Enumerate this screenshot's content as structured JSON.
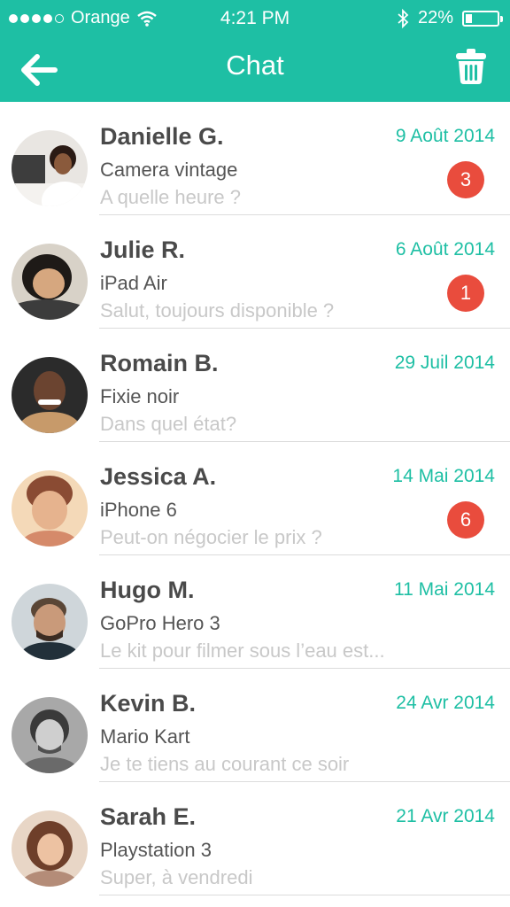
{
  "status_bar": {
    "carrier": "Orange",
    "time": "4:21 PM",
    "battery": "22%",
    "battery_level": 0.22,
    "signal_bars_filled": 4,
    "signal_bars_total": 5
  },
  "header": {
    "title": "Chat",
    "back_icon": "arrow-left-icon",
    "trash_icon": "trash-icon",
    "background_color": "#1ebfa4"
  },
  "colors": {
    "accent": "#1ebfa4",
    "badge": "#e94c3d"
  },
  "conversations": [
    {
      "name": "Danielle G.",
      "item": "Camera vintage",
      "preview": "A quelle heure ?",
      "date": "9 Août 2014",
      "unread": "3",
      "avatar": "avatar-danielle"
    },
    {
      "name": "Julie R.",
      "item": "iPad Air",
      "preview": "Salut, toujours disponible ?",
      "date": "6 Août 2014",
      "unread": "1",
      "avatar": "avatar-julie"
    },
    {
      "name": "Romain B.",
      "item": "Fixie noir",
      "preview": "Dans quel état?",
      "date": "29 Juil 2014",
      "unread": "",
      "avatar": "avatar-romain"
    },
    {
      "name": "Jessica A.",
      "item": "iPhone 6",
      "preview": "Peut-on négocier le prix ?",
      "date": "14  Mai 2014",
      "unread": "6",
      "avatar": "avatar-jessica"
    },
    {
      "name": "Hugo M.",
      "item": "GoPro Hero 3",
      "preview": "Le kit pour filmer sous l’eau est...",
      "date": "11 Mai 2014",
      "unread": "",
      "avatar": "avatar-hugo"
    },
    {
      "name": "Kevin B.",
      "item": "Mario Kart",
      "preview": "Je te tiens au courant ce soir",
      "date": "24 Avr 2014",
      "unread": "",
      "avatar": "avatar-kevin"
    },
    {
      "name": "Sarah E.",
      "item": "Playstation 3",
      "preview": "Super, à vendredi",
      "date": "21 Avr 2014",
      "unread": "",
      "avatar": "avatar-sarah"
    }
  ]
}
